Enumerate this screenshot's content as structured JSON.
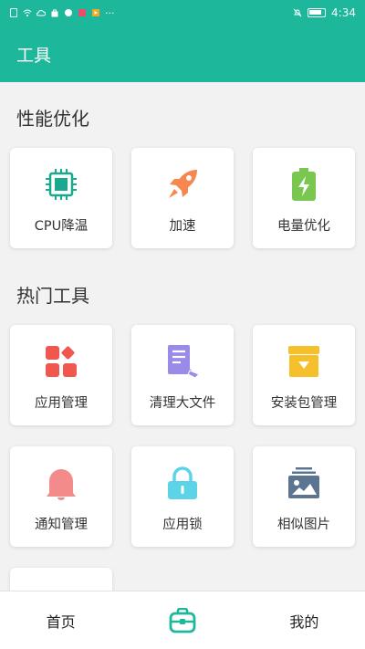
{
  "status_bar": {
    "time": "4:34",
    "icons": [
      "sim-icon",
      "wifi-icon",
      "cloud-icon",
      "bag-icon",
      "app-icon",
      "mute-icon",
      "battery-icon"
    ]
  },
  "app_bar": {
    "title": "工具"
  },
  "sections": {
    "performance": {
      "title": "性能优化",
      "items": [
        {
          "label": "CPU降温",
          "icon": "cpu-icon",
          "color": "#1aa88e"
        },
        {
          "label": "加速",
          "icon": "rocket-icon",
          "color": "#f5874f"
        },
        {
          "label": "电量优化",
          "icon": "battery-charge-icon",
          "color": "#7ac74f"
        }
      ]
    },
    "popular": {
      "title": "热门工具",
      "items": [
        {
          "label": "应用管理",
          "icon": "apps-grid-icon",
          "color": "#f0574e"
        },
        {
          "label": "清理大文件",
          "icon": "document-clean-icon",
          "color": "#9a8be8"
        },
        {
          "label": "安装包管理",
          "icon": "package-icon",
          "color": "#f5c02c"
        },
        {
          "label": "通知管理",
          "icon": "bell-icon",
          "color": "#f38b8b"
        },
        {
          "label": "应用锁",
          "icon": "lock-icon",
          "color": "#5dd3e8"
        },
        {
          "label": "相似图片",
          "icon": "image-icon",
          "color": "#5b7590"
        }
      ]
    }
  },
  "bottom_nav": {
    "home_label": "首页",
    "toolbox_icon": "toolbox-icon",
    "mine_label": "我的",
    "accent": "#1db89c"
  }
}
